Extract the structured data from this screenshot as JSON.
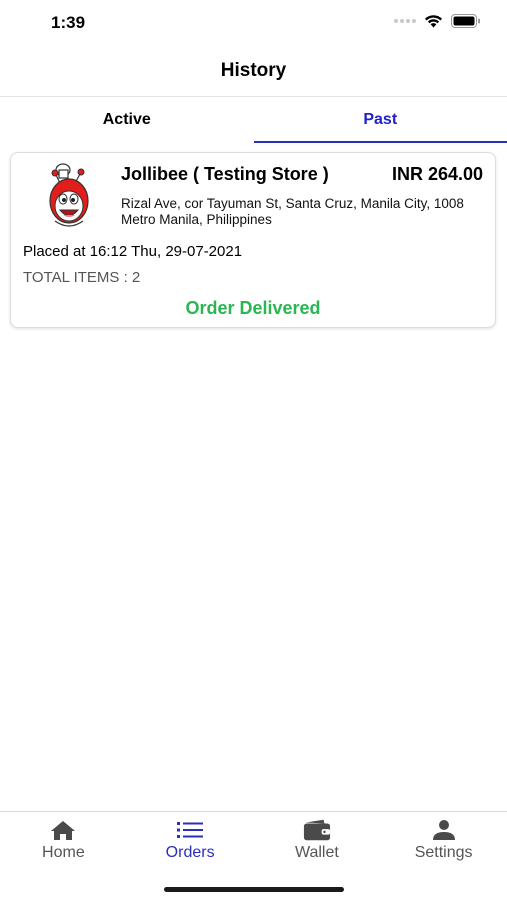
{
  "status_bar": {
    "time": "1:39"
  },
  "nav": {
    "title": "History"
  },
  "tabs": [
    {
      "label": "Active",
      "selected": false
    },
    {
      "label": "Past",
      "selected": true
    }
  ],
  "orders": [
    {
      "store_name": "Jollibee ( Testing Store )",
      "price": "INR 264.00",
      "address": "Rizal Ave, cor Tayuman St, Santa Cruz, Manila City, 1008 Metro Manila, Philippines",
      "placed_at": "Placed at 16:12 Thu, 29-07-2021",
      "total_items": "TOTAL ITEMS : 2",
      "status": "Order Delivered",
      "logo_icon": "jollibee-mascot-logo"
    }
  ],
  "tab_bar": {
    "items": [
      {
        "label": "Home",
        "icon": "home-icon",
        "selected": false
      },
      {
        "label": "Orders",
        "icon": "list-icon",
        "selected": true
      },
      {
        "label": "Wallet",
        "icon": "wallet-icon",
        "selected": false
      },
      {
        "label": "Settings",
        "icon": "person-icon",
        "selected": false
      }
    ]
  },
  "colors": {
    "accent": "#2a2fc0",
    "delivered": "#2bb553"
  }
}
